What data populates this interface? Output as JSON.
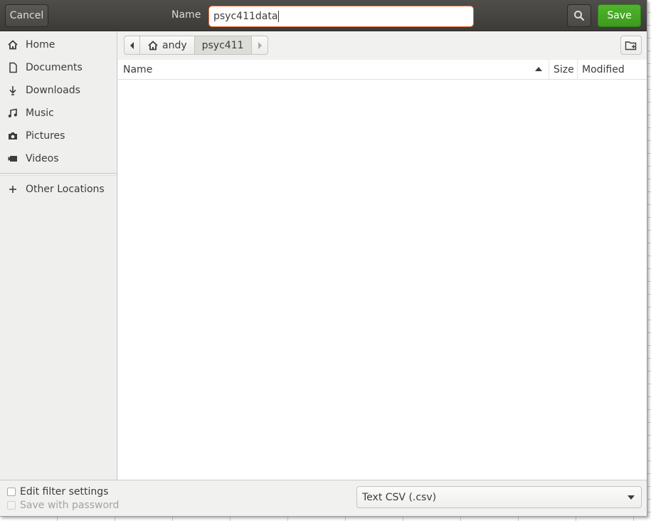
{
  "header": {
    "cancel_label": "Cancel",
    "name_label": "Name",
    "name_value": "psyc411data",
    "save_label": "Save"
  },
  "sidebar": {
    "items": [
      {
        "label": "Home",
        "icon": "home-icon"
      },
      {
        "label": "Documents",
        "icon": "document-icon"
      },
      {
        "label": "Downloads",
        "icon": "download-icon"
      },
      {
        "label": "Music",
        "icon": "music-icon"
      },
      {
        "label": "Pictures",
        "icon": "camera-icon"
      },
      {
        "label": "Videos",
        "icon": "video-icon"
      }
    ],
    "other_locations": {
      "label": "Other Locations",
      "icon": "plus-icon"
    }
  },
  "pathbar": {
    "segments": [
      "andy",
      "psyc411"
    ],
    "active": "psyc411"
  },
  "filelist": {
    "columns": [
      "Name",
      "Size",
      "Modified"
    ],
    "sort_column": "Name",
    "sort_direction": "ascending",
    "rows": []
  },
  "bottom": {
    "edit_filter_label": "Edit filter settings",
    "save_password_label": "Save with password",
    "filetype_value": "Text CSV (.csv)"
  },
  "colors": {
    "header_bg": "#3c3b37",
    "save_green": "#3e9a1f",
    "input_focus": "#e56a2f"
  }
}
